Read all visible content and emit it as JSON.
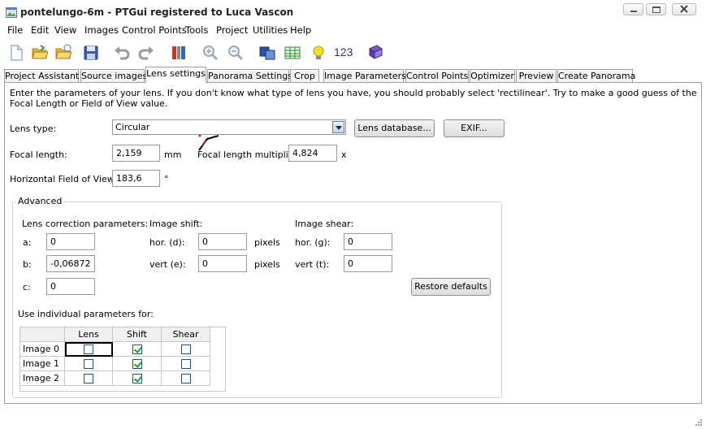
{
  "window": {
    "title": "pontelungo-6m - PTGui registered to Luca Vascon"
  },
  "menu": [
    "File",
    "Edit",
    "View",
    "Images",
    "Control Points",
    "Tools",
    "Project",
    "Utilities",
    "Help"
  ],
  "toolbar": {
    "counter_label": "123"
  },
  "tabs": [
    "Project Assistant",
    "Source images",
    "Lens settings",
    "Panorama Settings",
    "Crop",
    "Image Parameters",
    "Control Points",
    "Optimizer",
    "Preview",
    "Create Panorama"
  ],
  "active_tab": "Lens settings",
  "intro": "Enter the parameters of your lens. If you don't know what type of lens you have, you should probably select 'rectilinear'. Try to make a good guess of the Focal Length or Field of View value.",
  "lens": {
    "type_label": "Lens type:",
    "type_value": "Circular",
    "lens_db_button": "Lens database...",
    "exif_button": "EXIF...",
    "focal_label": "Focal length:",
    "focal_value": "2,159",
    "focal_unit": "mm",
    "multiplier_label": "Focal length multiplier:",
    "multiplier_value": "4,824",
    "multiplier_unit": "x",
    "hfov_label": "Horizontal Field of View:",
    "hfov_value": "183,6",
    "hfov_unit": "°"
  },
  "advanced": {
    "title": "Advanced",
    "correction_label": "Lens correction parameters:",
    "a_label": "a:",
    "a_value": "0",
    "b_label": "b:",
    "b_value": "-0,06872",
    "c_label": "c:",
    "c_value": "0",
    "shift_label": "Image shift:",
    "hor_d_label": "hor. (d):",
    "hor_d_value": "0",
    "vert_e_label": "vert (e):",
    "vert_e_value": "0",
    "pixels_label": "pixels",
    "shear_label": "Image shear:",
    "hor_g_label": "hor. (g):",
    "hor_g_value": "0",
    "vert_t_label": "vert (t):",
    "vert_t_value": "0",
    "restore_button": "Restore defaults",
    "individual_label": "Use individual parameters for:",
    "columns": [
      "Lens",
      "Shift",
      "Shear"
    ],
    "rows": [
      {
        "name": "Image 0",
        "lens": false,
        "shift": true,
        "shear": false
      },
      {
        "name": "Image 1",
        "lens": false,
        "shift": true,
        "shear": false
      },
      {
        "name": "Image 2",
        "lens": false,
        "shift": true,
        "shear": false
      }
    ]
  }
}
